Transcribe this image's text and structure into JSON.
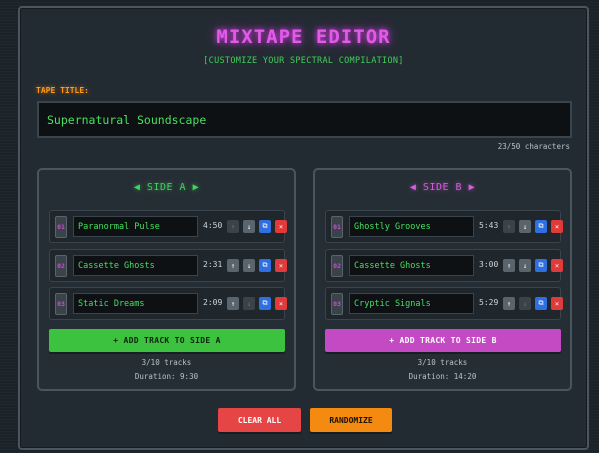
{
  "app": {
    "title": "MIXTAPE EDITOR",
    "subtitle": "[CUSTOMIZE YOUR SPECTRAL COMPILATION]"
  },
  "tape": {
    "label": "TAPE TITLE:",
    "value": "Supernatural Soundscape",
    "char_count": "23/50 characters"
  },
  "side_a": {
    "title": "◀ SIDE A ▶",
    "tracks": [
      {
        "num": "01",
        "name": "Paranormal Pulse",
        "duration": "4:50"
      },
      {
        "num": "02",
        "name": "Cassette Ghosts",
        "duration": "2:31"
      },
      {
        "num": "03",
        "name": "Static Dreams",
        "duration": "2:09"
      }
    ],
    "add_label": "+ ADD TRACK TO SIDE A",
    "track_count": "3/10 tracks",
    "duration": "Duration: 9:30"
  },
  "side_b": {
    "title": "◀ SIDE B ▶",
    "tracks": [
      {
        "num": "01",
        "name": "Ghostly Grooves",
        "duration": "5:43"
      },
      {
        "num": "02",
        "name": "Cassette Ghosts",
        "duration": "3:00"
      },
      {
        "num": "03",
        "name": "Cryptic Signals",
        "duration": "5:29"
      }
    ],
    "add_label": "+ ADD TRACK TO SIDE B",
    "track_count": "3/10 tracks",
    "duration": "Duration: 14:20"
  },
  "controls": {
    "up_glyph": "↑",
    "down_glyph": "↓",
    "dup_glyph": "⧉",
    "del_glyph": "×",
    "clear_label": "CLEAR ALL",
    "randomize_label": "RANDOMIZE"
  },
  "colors": {
    "accent_magenta": "#e15ae9",
    "accent_green": "#3fcf5a",
    "accent_orange": "#ff9a1a",
    "duplicate_blue": "#2f6fe0",
    "delete_red": "#e03a3a"
  }
}
